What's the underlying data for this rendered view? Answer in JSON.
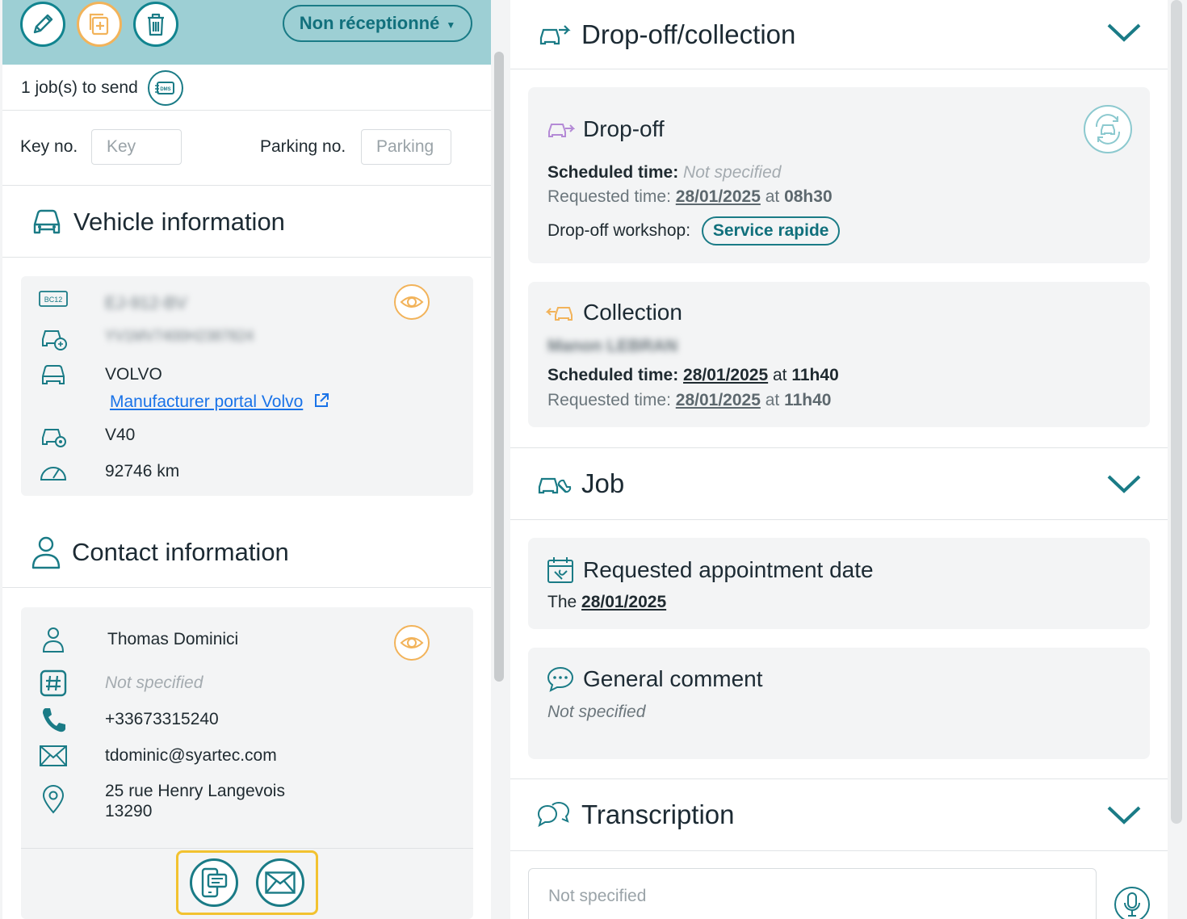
{
  "toolbar": {
    "status_label": "Non réceptionné"
  },
  "jobs": {
    "to_send_label": "1 job(s) to send"
  },
  "keys": {
    "key_label": "Key no.",
    "key_placeholder": "Key",
    "parking_label": "Parking no.",
    "parking_placeholder": "Parking"
  },
  "vehicle": {
    "title": "Vehicle information",
    "plate_icon_text": "BC12",
    "plate_blurred": "EJ-912-BV",
    "vin_blurred": "YV1MV7400H2387824",
    "brand": "VOLVO",
    "manufacturer_link": "Manufacturer portal Volvo",
    "model": "V40",
    "mileage": "92746 km"
  },
  "contact": {
    "title": "Contact information",
    "name": "Thomas Dominici",
    "id_number": "Not specified",
    "phone": "+33673315240",
    "email": "tdominic@syartec.com",
    "address_line1": "25 rue Henry Langevois",
    "address_line2": "13290"
  },
  "dropoff_collection": {
    "title": "Drop-off/collection",
    "dropoff": {
      "title": "Drop-off",
      "scheduled_label": "Scheduled time:",
      "scheduled_value": "Not specified",
      "requested_label": "Requested time:",
      "requested_date": "28/01/2025",
      "at": "at",
      "requested_time": "08h30",
      "workshop_label": "Drop-off workshop:",
      "workshop_value": "Service rapide"
    },
    "collection": {
      "title": "Collection",
      "person_blurred": "Manon LEBRAN",
      "scheduled_label": "Scheduled time:",
      "scheduled_date": "28/01/2025",
      "at": "at",
      "scheduled_time": "11h40",
      "requested_label": "Requested time:",
      "requested_date": "28/01/2025",
      "requested_time": "11h40"
    }
  },
  "job": {
    "title": "Job",
    "appointment_title": "Requested appointment date",
    "appointment_prefix": "The",
    "appointment_date": "28/01/2025",
    "comment_title": "General comment",
    "comment_value": "Not specified"
  },
  "transcription": {
    "title": "Transcription",
    "value": "Not specified"
  },
  "colors": {
    "teal": "#1a7b86",
    "toolbar_bg": "#9dcfd4",
    "orange": "#f2b35a",
    "highlight": "#f2c230",
    "link": "#1a73e8"
  }
}
